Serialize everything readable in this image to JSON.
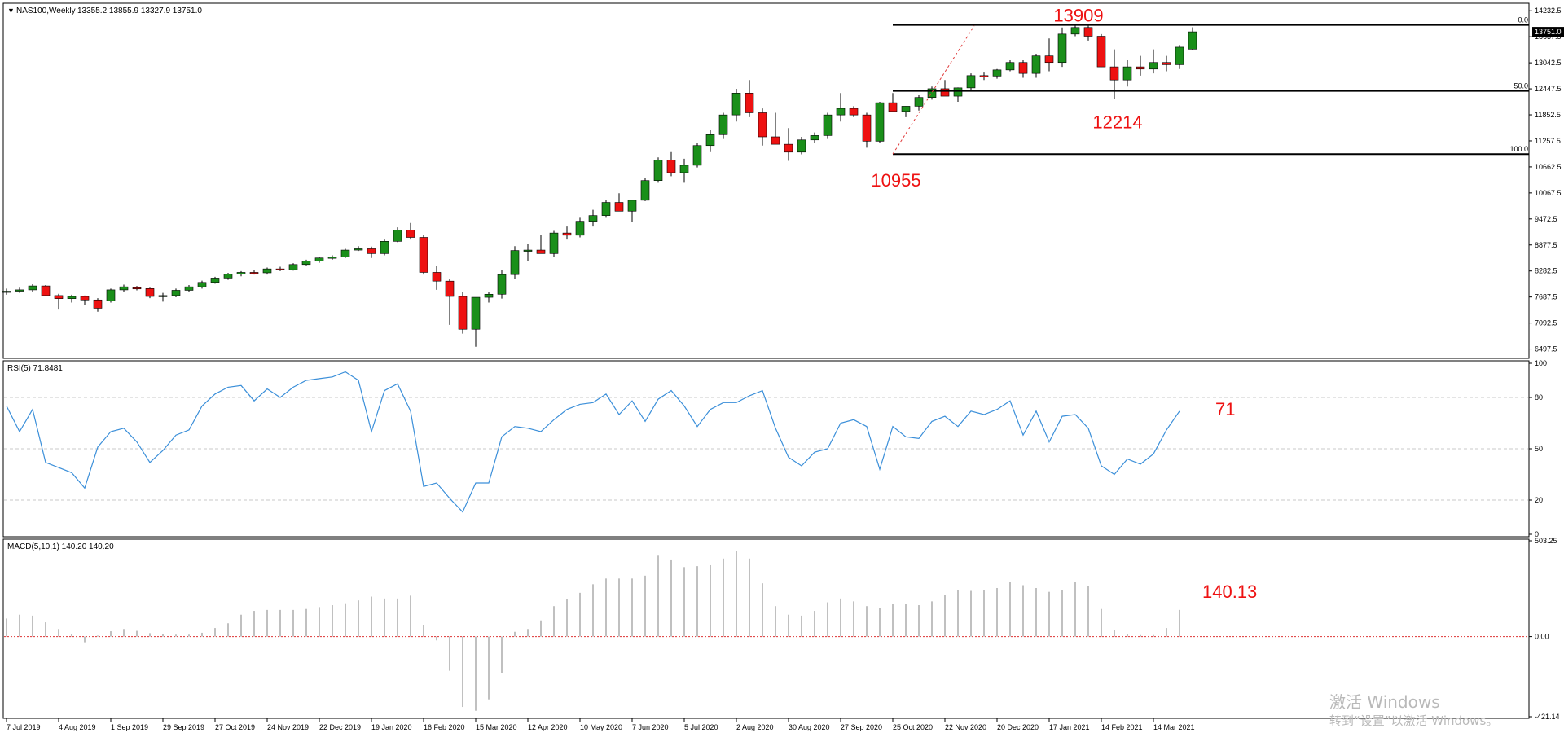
{
  "header": {
    "symbol": "NAS100,Weekly",
    "ohlc": "13355.2 13855.9 13327.9 13751.0"
  },
  "colors": {
    "bull": "#1a8f1a",
    "bear": "#ee1111",
    "rsi_line": "#3b8fd9",
    "macd_bar": "#c0c0c0",
    "annotation": "#ee1111",
    "grid": "#c8c8c8"
  },
  "chart_data": [
    {
      "type": "candlestick",
      "panel": "price",
      "title": "NAS100,Weekly",
      "ylim": [
        6340,
        14330
      ],
      "y_ticks": [
        "14232.5",
        "13637.5",
        "13042.5",
        "12447.5",
        "11852.5",
        "11257.5",
        "10662.5",
        "10067.5",
        "9472.5",
        "8877.5",
        "8282.5",
        "7687.5",
        "7092.5",
        "6497.5"
      ],
      "current_price_label": "13751.0",
      "x_ticks": [
        {
          "label": "7 Jul 2019",
          "bar": 0
        },
        {
          "label": "4 Aug 2019",
          "bar": 4
        },
        {
          "label": "1 Sep 2019",
          "bar": 8
        },
        {
          "label": "29 Sep 2019",
          "bar": 12
        },
        {
          "label": "27 Oct 2019",
          "bar": 16
        },
        {
          "label": "24 Nov 2019",
          "bar": 20
        },
        {
          "label": "22 Dec 2019",
          "bar": 24
        },
        {
          "label": "19 Jan 2020",
          "bar": 28
        },
        {
          "label": "16 Feb 2020",
          "bar": 32
        },
        {
          "label": "15 Mar 2020",
          "bar": 36
        },
        {
          "label": "12 Apr 2020",
          "bar": 40
        },
        {
          "label": "10 May 2020",
          "bar": 44
        },
        {
          "label": "7 Jun 2020",
          "bar": 48
        },
        {
          "label": "5 Jul 2020",
          "bar": 52
        },
        {
          "label": "2 Aug 2020",
          "bar": 56
        },
        {
          "label": "30 Aug 2020",
          "bar": 60
        },
        {
          "label": "27 Sep 2020",
          "bar": 64
        },
        {
          "label": "25 Oct 2020",
          "bar": 68
        },
        {
          "label": "22 Nov 2020",
          "bar": 72
        },
        {
          "label": "20 Dec 2020",
          "bar": 76
        },
        {
          "label": "17 Jan 2021",
          "bar": 80
        },
        {
          "label": "14 Feb 2021",
          "bar": 84
        },
        {
          "label": "14 Mar 2021",
          "bar": 88
        }
      ],
      "candles": [
        [
          7800,
          7880,
          7740,
          7820
        ],
        [
          7820,
          7900,
          7780,
          7850
        ],
        [
          7850,
          7980,
          7800,
          7940
        ],
        [
          7940,
          7960,
          7700,
          7720
        ],
        [
          7720,
          7760,
          7400,
          7650
        ],
        [
          7650,
          7740,
          7560,
          7700
        ],
        [
          7700,
          7720,
          7500,
          7620
        ],
        [
          7620,
          7660,
          7350,
          7430
        ],
        [
          7600,
          7880,
          7560,
          7850
        ],
        [
          7850,
          7970,
          7800,
          7920
        ],
        [
          7900,
          7940,
          7840,
          7880
        ],
        [
          7880,
          7900,
          7660,
          7700
        ],
        [
          7700,
          7780,
          7580,
          7720
        ],
        [
          7720,
          7880,
          7680,
          7840
        ],
        [
          7840,
          7960,
          7800,
          7920
        ],
        [
          7920,
          8060,
          7880,
          8020
        ],
        [
          8020,
          8150,
          7990,
          8120
        ],
        [
          8120,
          8240,
          8080,
          8210
        ],
        [
          8210,
          8280,
          8160,
          8250
        ],
        [
          8250,
          8300,
          8200,
          8240
        ],
        [
          8240,
          8360,
          8200,
          8330
        ],
        [
          8330,
          8380,
          8280,
          8310
        ],
        [
          8310,
          8460,
          8290,
          8430
        ],
        [
          8430,
          8540,
          8410,
          8510
        ],
        [
          8510,
          8600,
          8470,
          8580
        ],
        [
          8580,
          8640,
          8540,
          8600
        ],
        [
          8600,
          8790,
          8580,
          8760
        ],
        [
          8760,
          8850,
          8740,
          8790
        ],
        [
          8790,
          8840,
          8580,
          8680
        ],
        [
          8680,
          9000,
          8640,
          8960
        ],
        [
          8960,
          9280,
          8940,
          9220
        ],
        [
          9220,
          9380,
          9000,
          9050
        ],
        [
          9050,
          9100,
          8200,
          8250
        ],
        [
          8250,
          8400,
          7850,
          8050
        ],
        [
          8050,
          8100,
          7050,
          7700
        ],
        [
          7700,
          7800,
          6850,
          6950
        ],
        [
          6950,
          7680,
          6550,
          7680
        ],
        [
          7680,
          7800,
          7560,
          7750
        ],
        [
          7750,
          8300,
          7650,
          8200
        ],
        [
          8200,
          8850,
          8100,
          8750
        ],
        [
          8750,
          8900,
          8500,
          8760
        ],
        [
          8760,
          9100,
          8700,
          8680
        ],
        [
          8680,
          9200,
          8600,
          9150
        ],
        [
          9150,
          9300,
          9000,
          9100
        ],
        [
          9100,
          9500,
          9050,
          9420
        ],
        [
          9420,
          9680,
          9300,
          9550
        ],
        [
          9550,
          9900,
          9500,
          9850
        ],
        [
          9850,
          10060,
          9720,
          9650
        ],
        [
          9650,
          9900,
          9400,
          9900
        ],
        [
          9900,
          10400,
          9880,
          10350
        ],
        [
          10350,
          10880,
          10300,
          10820
        ],
        [
          10820,
          11000,
          10450,
          10530
        ],
        [
          10530,
          10850,
          10300,
          10700
        ],
        [
          10700,
          11200,
          10650,
          11150
        ],
        [
          11150,
          11500,
          11000,
          11400
        ],
        [
          11400,
          11900,
          11300,
          11850
        ],
        [
          11850,
          12450,
          11700,
          12350
        ],
        [
          12350,
          12650,
          11800,
          11900
        ],
        [
          11900,
          12000,
          11150,
          11350
        ],
        [
          11350,
          11900,
          11200,
          11180
        ],
        [
          11180,
          11550,
          10800,
          11000
        ],
        [
          11000,
          11350,
          10950,
          11280
        ],
        [
          11280,
          11450,
          11200,
          11380
        ],
        [
          11380,
          11900,
          11300,
          11850
        ],
        [
          11850,
          12350,
          11700,
          12000
        ],
        [
          12000,
          12050,
          11800,
          11850
        ],
        [
          11850,
          11900,
          11100,
          11250
        ],
        [
          11250,
          12150,
          11200,
          12130
        ],
        [
          12130,
          12350,
          11950,
          11930
        ],
        [
          11930,
          12050,
          11800,
          12050
        ],
        [
          12050,
          12300,
          11950,
          12250
        ],
        [
          12250,
          12500,
          12200,
          12450
        ],
        [
          12450,
          12650,
          12300,
          12280
        ],
        [
          12280,
          12480,
          12150,
          12470
        ],
        [
          12470,
          12800,
          12420,
          12750
        ],
        [
          12750,
          12820,
          12650,
          12740
        ],
        [
          12740,
          12900,
          12680,
          12880
        ],
        [
          12880,
          13100,
          12850,
          13050
        ],
        [
          13050,
          13100,
          12700,
          12800
        ],
        [
          12800,
          13250,
          12700,
          13200
        ],
        [
          13200,
          13600,
          12850,
          13050
        ],
        [
          13050,
          13850,
          12950,
          13700
        ],
        [
          13700,
          13909,
          13650,
          13850
        ],
        [
          13850,
          13900,
          13550,
          13650
        ],
        [
          13650,
          13700,
          12950,
          12950
        ],
        [
          12950,
          13350,
          12214,
          12650
        ],
        [
          12650,
          13100,
          12500,
          12950
        ],
        [
          12950,
          13200,
          12750,
          12900
        ],
        [
          12900,
          13350,
          12800,
          13050
        ],
        [
          13050,
          13200,
          12850,
          13000
        ],
        [
          13000,
          13450,
          12900,
          13400
        ],
        [
          13355.2,
          13855.9,
          13327.9,
          13751.0
        ]
      ],
      "fibonacci": {
        "levels": [
          {
            "label": "0.0",
            "price": 13909
          },
          {
            "label": "50.0",
            "price": 12400
          },
          {
            "label": "100.0",
            "price": 10955
          }
        ]
      },
      "annotations": [
        {
          "text": "13909",
          "bar": 82,
          "price": 13909
        },
        {
          "text": "12214",
          "bar": 85,
          "price": 12214
        },
        {
          "text": "10955",
          "bar": 68,
          "price": 10955
        }
      ]
    },
    {
      "type": "line",
      "panel": "rsi",
      "title": "RSI(5) 71.8481",
      "ylim": [
        0,
        100
      ],
      "y_ticks": [
        "100",
        "80",
        "50",
        "20",
        "0"
      ],
      "levels": [
        80,
        50,
        20
      ],
      "values": [
        75,
        60,
        73,
        42,
        39,
        36,
        27,
        51,
        60,
        62,
        54,
        42,
        49,
        58,
        61,
        75,
        82,
        86,
        87,
        78,
        85,
        80,
        86,
        90,
        91,
        92,
        95,
        90,
        60,
        84,
        88,
        72,
        28,
        30,
        21,
        13,
        30,
        30,
        57,
        63,
        62,
        60,
        67,
        73,
        76,
        77,
        82,
        70,
        78,
        66,
        79,
        84,
        75,
        63,
        73,
        77,
        77,
        81,
        84,
        62,
        45,
        40,
        48,
        50,
        65,
        67,
        63,
        38,
        63,
        57,
        56,
        66,
        69,
        63,
        72,
        70,
        73,
        78,
        58,
        72,
        54,
        69,
        70,
        62,
        40,
        35,
        44,
        41,
        47,
        61,
        72
      ],
      "annotation": "71"
    },
    {
      "type": "bar",
      "panel": "macd",
      "title": "MACD(5,10,1) 140.20 140.20",
      "ylim": [
        -421.14,
        503.25
      ],
      "y_ticks": [
        "503.25",
        "0.00",
        "-421.14"
      ],
      "values": [
        95,
        115,
        110,
        75,
        40,
        12,
        -30,
        5,
        28,
        40,
        30,
        18,
        15,
        10,
        10,
        20,
        45,
        70,
        115,
        135,
        140,
        140,
        140,
        145,
        155,
        165,
        175,
        190,
        210,
        200,
        200,
        215,
        60,
        -20,
        -180,
        -370,
        -390,
        -330,
        -190,
        25,
        40,
        85,
        160,
        195,
        230,
        275,
        305,
        305,
        305,
        320,
        425,
        405,
        365,
        370,
        375,
        410,
        450,
        410,
        280,
        160,
        115,
        110,
        135,
        180,
        200,
        185,
        160,
        150,
        170,
        170,
        165,
        185,
        220,
        245,
        240,
        245,
        255,
        285,
        270,
        255,
        235,
        245,
        285,
        265,
        145,
        35,
        15,
        8,
        8,
        45,
        140.13
      ],
      "annotation": "140.13"
    }
  ],
  "watermark": {
    "line1": "激活 Windows",
    "line2": "转到“设置”以激活 Windows。"
  }
}
